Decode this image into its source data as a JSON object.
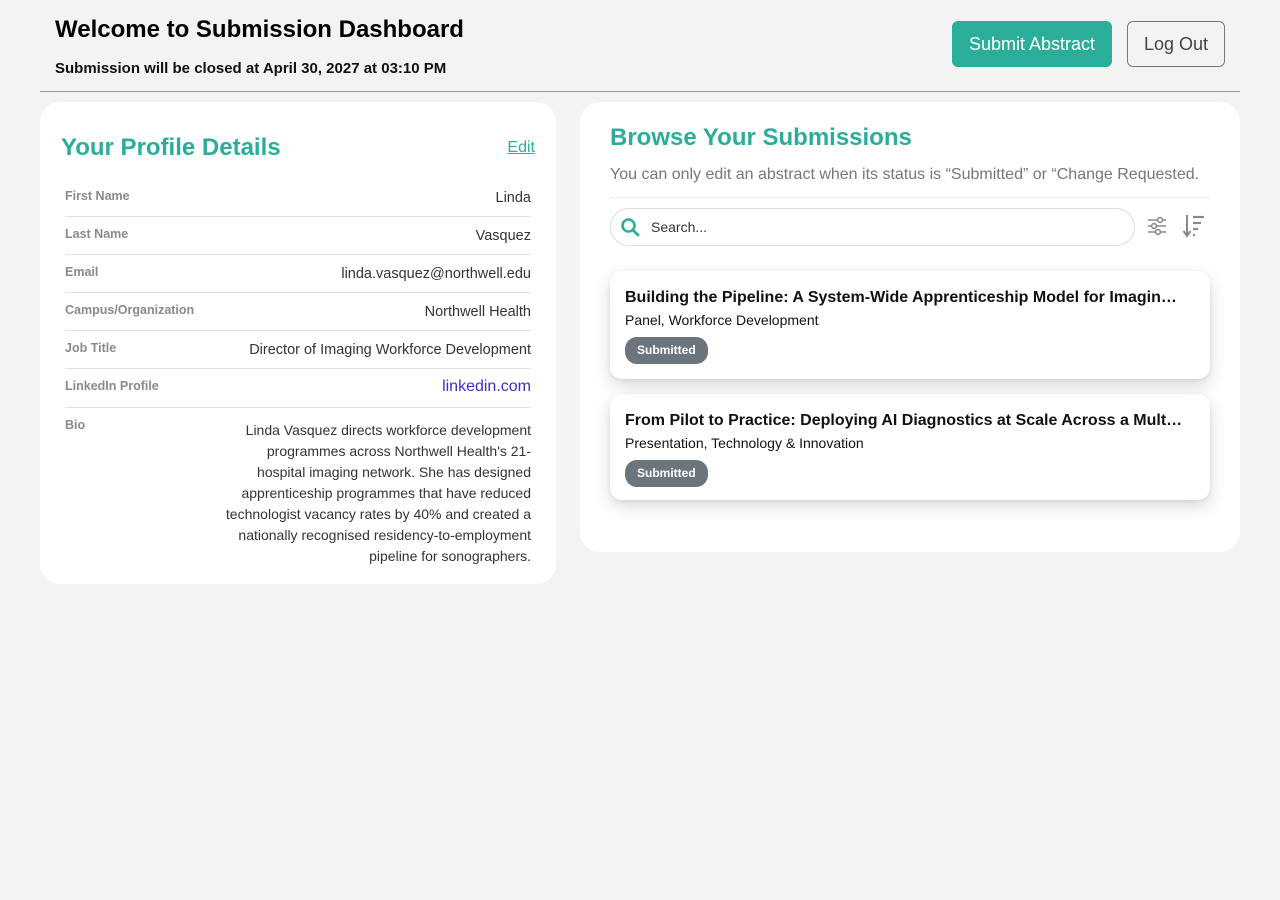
{
  "header": {
    "title": "Welcome to Submission Dashboard",
    "subtitle": "Submission will be closed at April 30, 2027 at 03:10 PM",
    "submit_label": "Submit Abstract",
    "logout_label": "Log Out"
  },
  "profile": {
    "title": "Your Profile Details",
    "edit_label": "Edit",
    "fields": [
      {
        "label": "First Name",
        "value": "Linda"
      },
      {
        "label": "Last Name",
        "value": "Vasquez"
      },
      {
        "label": "Email",
        "value": "linda.vasquez@northwell.edu"
      },
      {
        "label": "Campus/Organization",
        "value": "Northwell Health"
      },
      {
        "label": "Job Title",
        "value": "Director of Imaging Workforce Development"
      },
      {
        "label": "LinkedIn Profile",
        "value": "linkedin.com"
      },
      {
        "label": "Bio",
        "value": "Linda Vasquez directs workforce development programmes across Northwell Health's 21-hospital imaging network. She has designed apprenticeship programmes that have reduced technologist vacancy rates by 40% and created a nationally recognised residency-to-employment pipeline for sonographers."
      }
    ]
  },
  "submissions": {
    "title": "Browse Your Submissions",
    "note": "You can only edit an abstract when its status is “Submitted” or “Change Requested.",
    "search_placeholder": "Search...",
    "items": [
      {
        "title": "Building the Pipeline: A System-Wide Apprenticeship Model for Imaging Workforce Development",
        "meta": "Panel, Workforce Development",
        "status": "Submitted"
      },
      {
        "title": "From Pilot to Practice: Deploying AI Diagnostics at Scale Across a Multi-Hospital System",
        "meta": "Presentation, Technology & Innovation",
        "status": "Submitted"
      }
    ]
  },
  "colors": {
    "accent": "#2aae99",
    "badge": "#6c757d",
    "link": "#3b2fc9",
    "background": "#f3f3f3"
  },
  "icons": {
    "search": "search-icon",
    "filter": "sliders-icon",
    "sort": "sort-descending-icon"
  }
}
